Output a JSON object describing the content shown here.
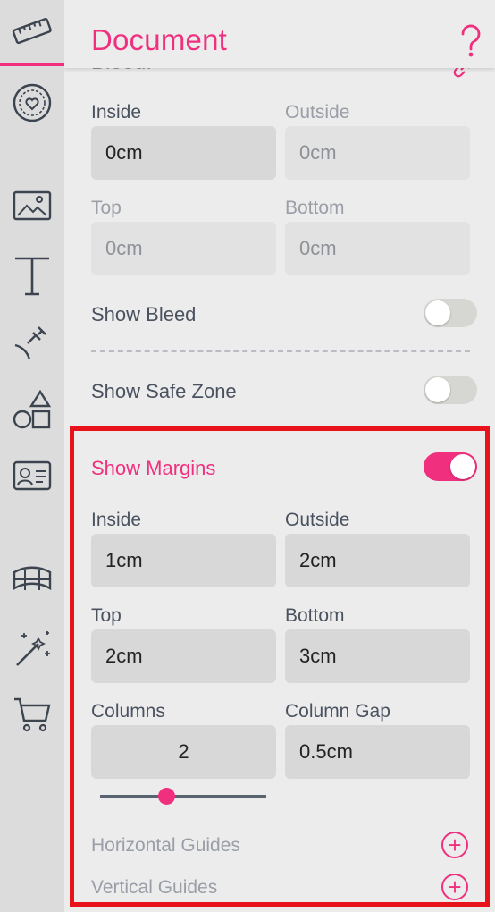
{
  "header": {
    "title": "Document"
  },
  "bleed": {
    "section_label": "Bleed:",
    "inside_label": "Inside",
    "inside_value": "0cm",
    "outside_label": "Outside",
    "outside_value": "0cm",
    "top_label": "Top",
    "top_value": "0cm",
    "bottom_label": "Bottom",
    "bottom_value": "0cm",
    "show_bleed_label": "Show Bleed",
    "show_bleed_on": false
  },
  "safe_zone": {
    "label": "Show Safe Zone",
    "on": false
  },
  "margins": {
    "label": "Show Margins",
    "on": true,
    "inside_label": "Inside",
    "inside_value": "1cm",
    "outside_label": "Outside",
    "outside_value": "2cm",
    "top_label": "Top",
    "top_value": "2cm",
    "bottom_label": "Bottom",
    "bottom_value": "3cm",
    "columns_label": "Columns",
    "columns_value": "2",
    "column_gap_label": "Column Gap",
    "column_gap_value": "0.5cm",
    "columns_slider_fraction": 0.4,
    "horizontal_guides_label": "Horizontal Guides",
    "vertical_guides_label": "Vertical Guides",
    "add_symbol": "+"
  },
  "sidebar_icons": [
    "ruler-icon",
    "badge-heart-icon",
    "image-icon",
    "text-icon",
    "pen-tool-icon",
    "shapes-icon",
    "id-card-icon",
    "banner-icon",
    "magic-wand-icon",
    "cart-icon"
  ],
  "colors": {
    "accent": "#f0307f",
    "highlight_border": "#e8121b",
    "sidebar_bg": "#dcdcdc",
    "panel_bg": "#ececec"
  }
}
